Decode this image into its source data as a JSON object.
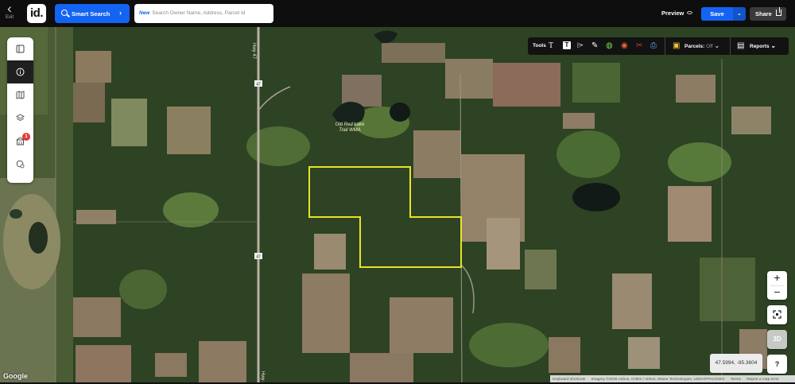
{
  "topbar": {
    "exit_label": "Exit",
    "logo_text": "id.",
    "smart_search_label": "Smart Search",
    "search": {
      "badge": "New",
      "placeholder": "Search Owner Name, Address, Parcel Id"
    },
    "preview_label": "Preview",
    "save_label": "Save",
    "share_label": "Share"
  },
  "left_toolbar": {
    "items": [
      {
        "icon": "panel-icon"
      },
      {
        "icon": "info-icon",
        "active": true
      },
      {
        "icon": "map-icon"
      },
      {
        "icon": "layers-icon"
      },
      {
        "icon": "buildings-icon",
        "badge": "1"
      },
      {
        "icon": "location-settings-icon"
      }
    ]
  },
  "tools_bar": {
    "tools_label": "Tools",
    "parcels_label": "Parcels:",
    "parcels_state": "Off",
    "reports_label": "Reports"
  },
  "map": {
    "place_label": "Old Red Lake Trail WMA",
    "place_label_line1": "Old Red Lake",
    "place_label_line2": "Trail WMA",
    "highway_shield": "47",
    "road_name": "Hwy 47",
    "parcel_outline_color": "#e8e22a"
  },
  "controls": {
    "zoom_in": "+",
    "zoom_out": "−",
    "three_d_label": "3D",
    "help_label": "?",
    "coordinates": "47.5994, -95.3604"
  },
  "attribution": {
    "google": "Google",
    "keyboard": "Keyboard shortcuts",
    "imagery": "Imagery ©2025 Airbus, CNES / Airbus, Maxar Technologies, USDA/FPAC/GEO",
    "terms": "Terms",
    "report": "Report a map error"
  }
}
